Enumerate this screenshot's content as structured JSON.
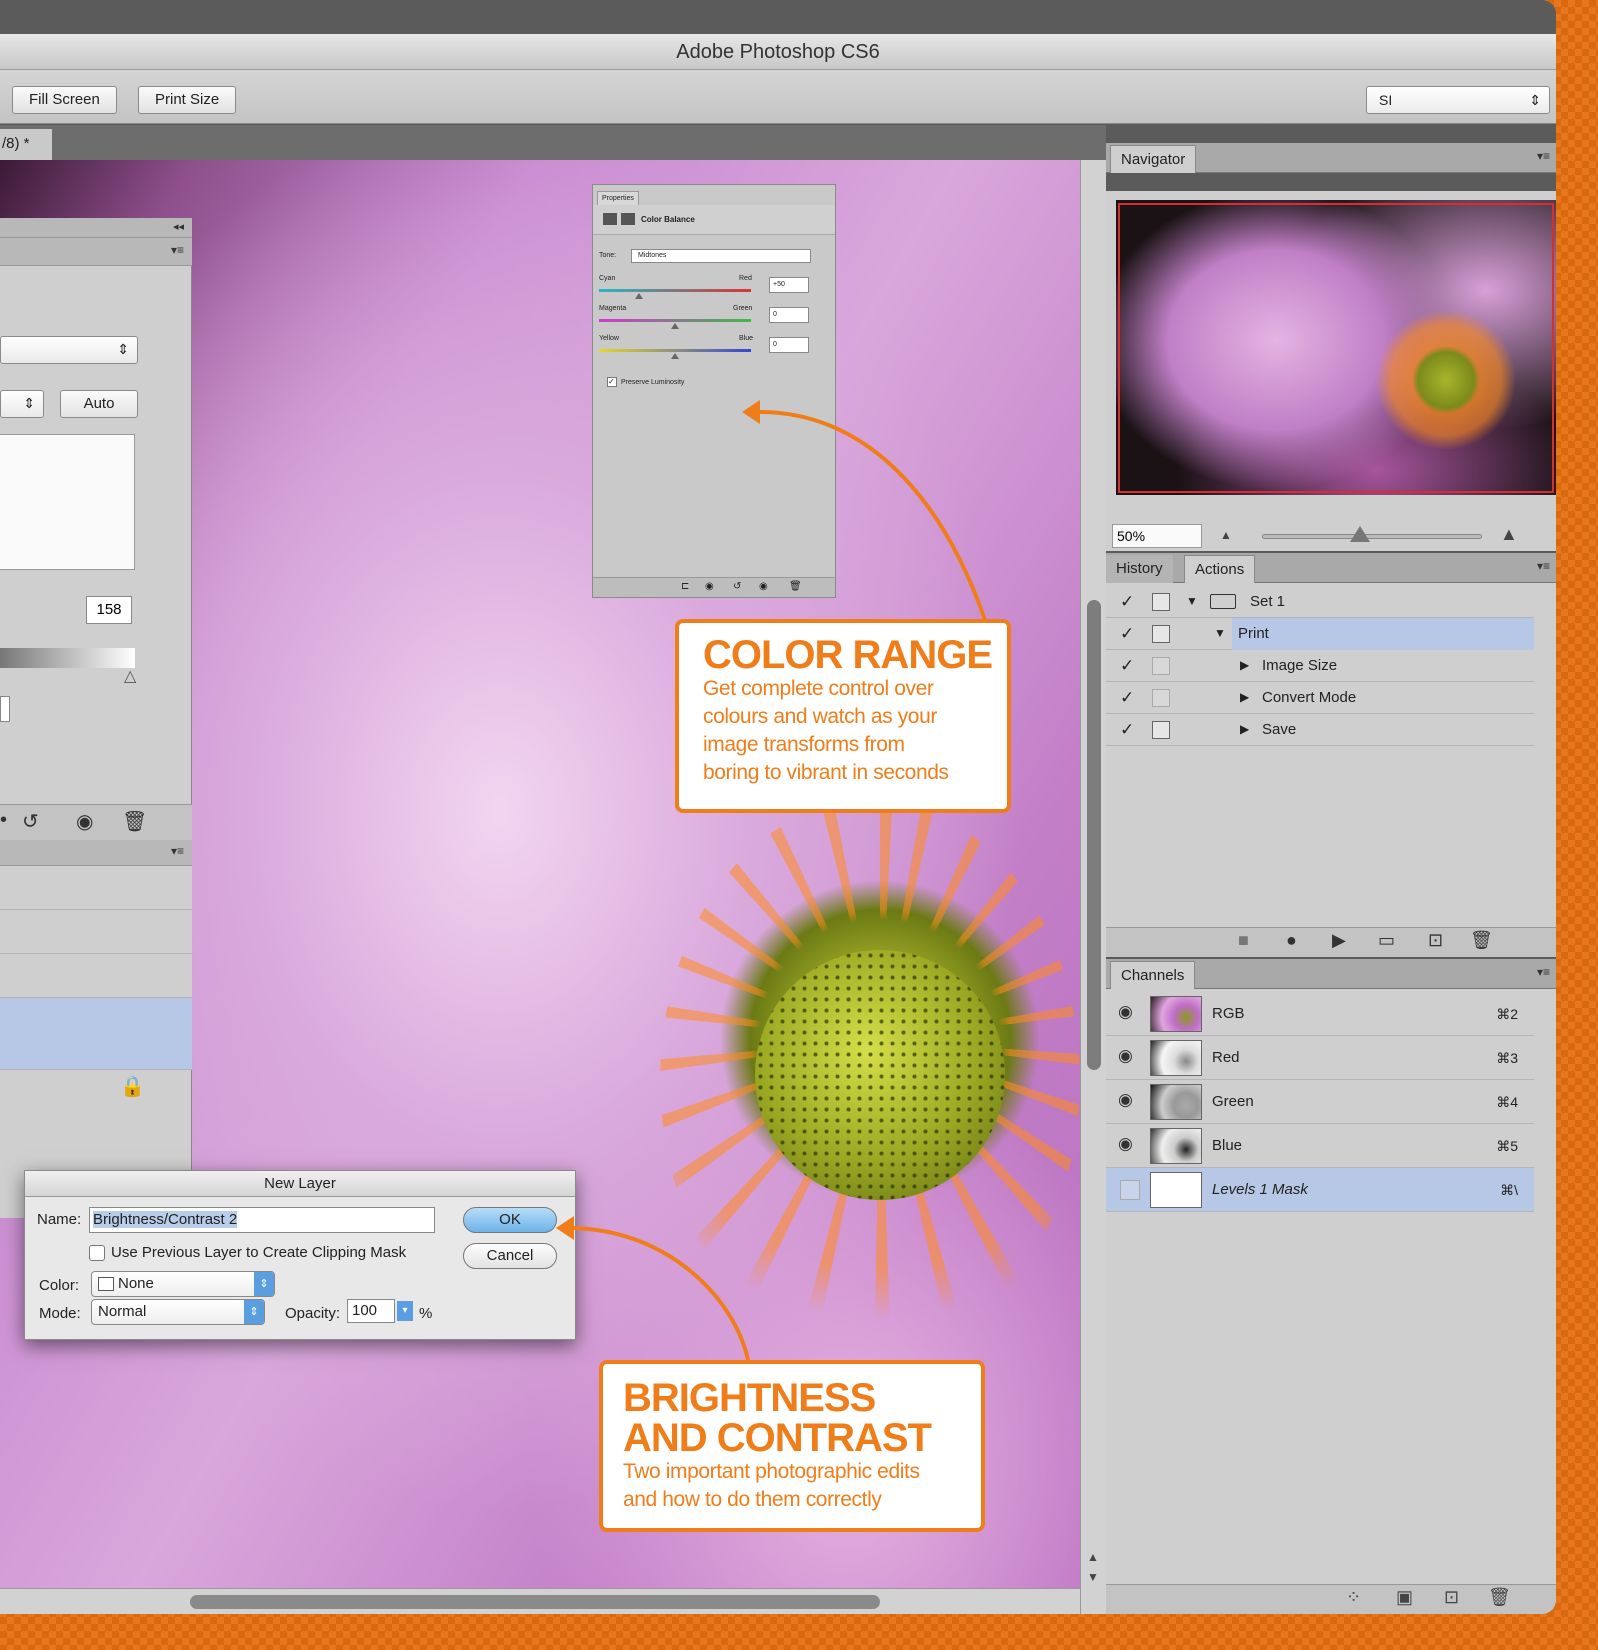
{
  "window": {
    "title": "Adobe Photoshop CS6"
  },
  "options_bar": {
    "fill_screen": "Fill Screen",
    "print_size": "Print Size",
    "preset_select": "SI"
  },
  "document_tab": {
    "label": "/8) *"
  },
  "left_panel": {
    "auto_button": "Auto",
    "value": "158"
  },
  "properties_panel": {
    "tab": "Properties",
    "title": "Color Balance",
    "tone_label": "Tone:",
    "tone_value": "Midtones",
    "sliders": [
      {
        "left": "Cyan",
        "right": "Red",
        "value": "+50"
      },
      {
        "left": "Magenta",
        "right": "Green",
        "value": "0"
      },
      {
        "left": "Yellow",
        "right": "Blue",
        "value": "0"
      }
    ],
    "preserve_luminosity": "Preserve Luminosity"
  },
  "navigator": {
    "tab": "Navigator",
    "zoom": "50%"
  },
  "history_actions": {
    "tabs": [
      "History",
      "Actions"
    ],
    "active_tab": "Actions",
    "rows": [
      {
        "label": "Set 1"
      },
      {
        "label": "Print"
      },
      {
        "label": "Image Size"
      },
      {
        "label": "Convert Mode"
      },
      {
        "label": "Save"
      }
    ]
  },
  "channels": {
    "tab": "Channels",
    "rows": [
      {
        "name": "RGB",
        "shortcut": "⌘2"
      },
      {
        "name": "Red",
        "shortcut": "⌘3"
      },
      {
        "name": "Green",
        "shortcut": "⌘4"
      },
      {
        "name": "Blue",
        "shortcut": "⌘5"
      },
      {
        "name": "Levels 1 Mask",
        "shortcut": "⌘\\"
      }
    ]
  },
  "new_layer_dialog": {
    "title": "New Layer",
    "name_label": "Name:",
    "name_value": "Brightness/Contrast 2",
    "clipping_label": "Use Previous Layer to Create Clipping Mask",
    "color_label": "Color:",
    "color_value": "None",
    "mode_label": "Mode:",
    "mode_value": "Normal",
    "opacity_label": "Opacity:",
    "opacity_value": "100",
    "opacity_unit": "%",
    "ok": "OK",
    "cancel": "Cancel"
  },
  "callouts": {
    "color_range": {
      "title": "COLOR RANGE",
      "lines": [
        "Get complete control over",
        "colours and watch as your",
        "image transforms from",
        "boring to vibrant in seconds"
      ]
    },
    "brightness": {
      "title_1": "BRIGHTNESS",
      "title_2": "AND CONTRAST",
      "lines": [
        "Two important photographic edits",
        "and how to do them correctly"
      ]
    }
  },
  "colors": {
    "accent": "#ef7d1a",
    "selection": "#b7c8e6"
  }
}
